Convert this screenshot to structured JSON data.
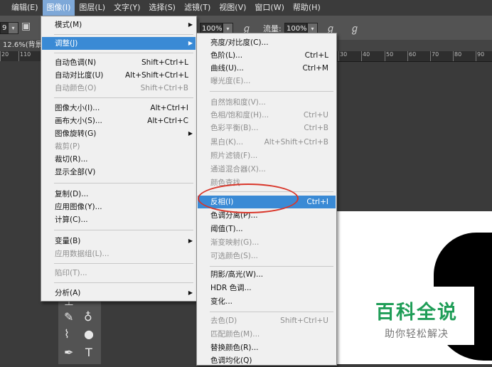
{
  "menubar": {
    "items": [
      "编辑(E)",
      "图像(I)",
      "图层(L)",
      "文字(Y)",
      "选择(S)",
      "滤镜(T)",
      "视图(V)",
      "窗口(W)",
      "帮助(H)"
    ]
  },
  "options": {
    "left_value": "9",
    "opacity_value": "100%",
    "flow_label": "流量:",
    "flow_value": "100%"
  },
  "doc_tab": "12.6%(背景",
  "ruler": {
    "left_ticks": [
      "20",
      "110"
    ],
    "right_ticks": [
      "30",
      "40",
      "50",
      "60",
      "70",
      "80",
      "90"
    ]
  },
  "image_menu": [
    {
      "label": "模式(M)",
      "shortcut": "",
      "arrow": true,
      "disabled": false
    },
    {
      "label": "调整(J)",
      "shortcut": "",
      "arrow": true,
      "disabled": false,
      "highlight": true
    },
    {
      "label": "自动色调(N)",
      "shortcut": "Shift+Ctrl+L",
      "disabled": false
    },
    {
      "label": "自动对比度(U)",
      "shortcut": "Alt+Shift+Ctrl+L",
      "disabled": false
    },
    {
      "label": "自动颜色(O)",
      "shortcut": "Shift+Ctrl+B",
      "disabled": true
    },
    {
      "label": "图像大小(I)...",
      "shortcut": "Alt+Ctrl+I",
      "disabled": false
    },
    {
      "label": "画布大小(S)...",
      "shortcut": "Alt+Ctrl+C",
      "disabled": false
    },
    {
      "label": "图像旋转(G)",
      "shortcut": "",
      "arrow": true,
      "disabled": false
    },
    {
      "label": "裁剪(P)",
      "shortcut": "",
      "disabled": true
    },
    {
      "label": "裁切(R)...",
      "shortcut": "",
      "disabled": false
    },
    {
      "label": "显示全部(V)",
      "shortcut": "",
      "disabled": false
    },
    {
      "label": "复制(D)...",
      "shortcut": "",
      "disabled": false
    },
    {
      "label": "应用图像(Y)...",
      "shortcut": "",
      "disabled": false
    },
    {
      "label": "计算(C)...",
      "shortcut": "",
      "disabled": false
    },
    {
      "label": "变量(B)",
      "shortcut": "",
      "arrow": true,
      "disabled": false
    },
    {
      "label": "应用数据组(L)...",
      "shortcut": "",
      "disabled": true
    },
    {
      "label": "陷印(T)...",
      "shortcut": "",
      "disabled": true
    },
    {
      "label": "分析(A)",
      "shortcut": "",
      "arrow": true,
      "disabled": false
    }
  ],
  "adjust_menu": [
    {
      "label": "亮度/对比度(C)...",
      "shortcut": "",
      "disabled": false
    },
    {
      "label": "色阶(L)...",
      "shortcut": "Ctrl+L",
      "disabled": false
    },
    {
      "label": "曲线(U)...",
      "shortcut": "Ctrl+M",
      "disabled": false
    },
    {
      "label": "曝光度(E)...",
      "shortcut": "",
      "disabled": true
    },
    {
      "label": "自然饱和度(V)...",
      "shortcut": "",
      "disabled": true
    },
    {
      "label": "色相/饱和度(H)...",
      "shortcut": "Ctrl+U",
      "disabled": true
    },
    {
      "label": "色彩平衡(B)...",
      "shortcut": "Ctrl+B",
      "disabled": true
    },
    {
      "label": "黑白(K)...",
      "shortcut": "Alt+Shift+Ctrl+B",
      "disabled": true
    },
    {
      "label": "照片滤镜(F)...",
      "shortcut": "",
      "disabled": true
    },
    {
      "label": "通道混合器(X)...",
      "shortcut": "",
      "disabled": true
    },
    {
      "label": "颜色查找...",
      "shortcut": "",
      "disabled": true
    },
    {
      "label": "反相(I)",
      "shortcut": "Ctrl+I",
      "disabled": false,
      "highlight": true
    },
    {
      "label": "色调分离(P)...",
      "shortcut": "",
      "disabled": false
    },
    {
      "label": "阈值(T)...",
      "shortcut": "",
      "disabled": false
    },
    {
      "label": "渐变映射(G)...",
      "shortcut": "",
      "disabled": true
    },
    {
      "label": "可选颜色(S)...",
      "shortcut": "",
      "disabled": true
    },
    {
      "label": "阴影/高光(W)...",
      "shortcut": "",
      "disabled": false
    },
    {
      "label": "HDR 色调...",
      "shortcut": "",
      "disabled": false
    },
    {
      "label": "变化...",
      "shortcut": "",
      "disabled": false
    },
    {
      "label": "去色(D)",
      "shortcut": "Shift+Ctrl+U",
      "disabled": true
    },
    {
      "label": "匹配颜色(M)...",
      "shortcut": "",
      "disabled": true
    },
    {
      "label": "替换颜色(R)...",
      "shortcut": "",
      "disabled": false
    },
    {
      "label": "色调均化(Q)",
      "shortcut": "",
      "disabled": false
    }
  ],
  "watermark": {
    "title": "百科全说",
    "subtitle": "助你轻松解决"
  },
  "colors": {
    "highlight": "#3a8ad5",
    "annotation": "#d9362a",
    "watermark_green": "#1f9d57"
  }
}
